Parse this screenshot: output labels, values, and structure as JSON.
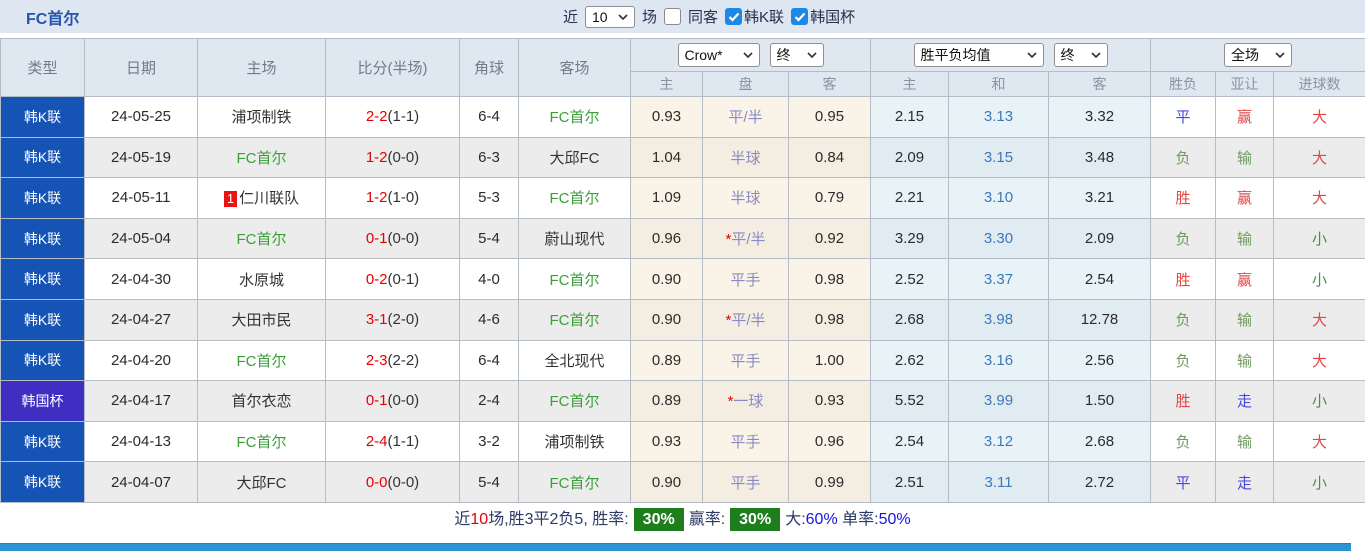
{
  "colors": {
    "league_badge_bg": "#1553b4",
    "cup_badge_bg": "#3e2ec2",
    "self_team_green": "#3aa03a",
    "score_red": "#e60000",
    "handicap_purple": "#8a8ac2",
    "draw_odds_blue": "#3f77b8",
    "status_red": "#e44545",
    "status_blue": "#4646e0",
    "status_green": "#6e9a60",
    "summary_badge_green": "#1e7e1e",
    "bottom_bar_blue": "#2b94d1",
    "checkbox_blue": "#1e88e5"
  },
  "topbar": {
    "title": "FC首尔",
    "recent_label": "近",
    "recent_count": "10",
    "unit_label": "场",
    "checkboxes": [
      {
        "id": "same-venue",
        "label": "同客",
        "checked": false
      },
      {
        "id": "league",
        "label": "韩K联",
        "checked": true
      },
      {
        "id": "cup",
        "label": "韩国杯",
        "checked": true
      }
    ]
  },
  "table": {
    "headers": {
      "type": "类型",
      "date": "日期",
      "home": "主场",
      "score": "比分(半场)",
      "corner": "角球",
      "away": "客场"
    },
    "controls": {
      "book": "Crow*",
      "book_state": "终",
      "avg": "胜平负均值",
      "avg_state": "终",
      "scope": "全场"
    },
    "sub_headers": [
      "主",
      "盘",
      "客",
      "主",
      "和",
      "客",
      "胜负",
      "亚让",
      "进球数"
    ],
    "rows": [
      {
        "type": "韩K联",
        "cup": false,
        "date": "24-05-25",
        "home": "浦项制铁",
        "home_self": false,
        "home_badge": "",
        "score": "2-2",
        "half": "(1-1)",
        "corner": "6-4",
        "away": "FC首尔",
        "away_self": true,
        "ah_home": "0.93",
        "ah_star": false,
        "ah_line": "平/半",
        "ah_away": "0.95",
        "avg_home": "2.15",
        "avg_draw": "3.13",
        "avg_away": "3.32",
        "result": "平",
        "handicap_result": "赢",
        "goals_result": "大"
      },
      {
        "type": "韩K联",
        "cup": false,
        "date": "24-05-19",
        "home": "FC首尔",
        "home_self": true,
        "home_badge": "",
        "score": "1-2",
        "half": "(0-0)",
        "corner": "6-3",
        "away": "大邱FC",
        "away_self": false,
        "ah_home": "1.04",
        "ah_star": false,
        "ah_line": "半球",
        "ah_away": "0.84",
        "avg_home": "2.09",
        "avg_draw": "3.15",
        "avg_away": "3.48",
        "result": "负",
        "handicap_result": "输",
        "goals_result": "大"
      },
      {
        "type": "韩K联",
        "cup": false,
        "date": "24-05-11",
        "home": "仁川联队",
        "home_self": false,
        "home_badge": "1",
        "score": "1-2",
        "half": "(1-0)",
        "corner": "5-3",
        "away": "FC首尔",
        "away_self": true,
        "ah_home": "1.09",
        "ah_star": false,
        "ah_line": "半球",
        "ah_away": "0.79",
        "avg_home": "2.21",
        "avg_draw": "3.10",
        "avg_away": "3.21",
        "result": "胜",
        "handicap_result": "赢",
        "goals_result": "大"
      },
      {
        "type": "韩K联",
        "cup": false,
        "date": "24-05-04",
        "home": "FC首尔",
        "home_self": true,
        "home_badge": "",
        "score": "0-1",
        "half": "(0-0)",
        "corner": "5-4",
        "away": "蔚山现代",
        "away_self": false,
        "ah_home": "0.96",
        "ah_star": true,
        "ah_line": "平/半",
        "ah_away": "0.92",
        "avg_home": "3.29",
        "avg_draw": "3.30",
        "avg_away": "2.09",
        "result": "负",
        "handicap_result": "输",
        "goals_result": "小"
      },
      {
        "type": "韩K联",
        "cup": false,
        "date": "24-04-30",
        "home": "水原城",
        "home_self": false,
        "home_badge": "",
        "score": "0-2",
        "half": "(0-1)",
        "corner": "4-0",
        "away": "FC首尔",
        "away_self": true,
        "ah_home": "0.90",
        "ah_star": false,
        "ah_line": "平手",
        "ah_away": "0.98",
        "avg_home": "2.52",
        "avg_draw": "3.37",
        "avg_away": "2.54",
        "result": "胜",
        "handicap_result": "赢",
        "goals_result": "小"
      },
      {
        "type": "韩K联",
        "cup": false,
        "date": "24-04-27",
        "home": "大田市民",
        "home_self": false,
        "home_badge": "",
        "score": "3-1",
        "half": "(2-0)",
        "corner": "4-6",
        "away": "FC首尔",
        "away_self": true,
        "ah_home": "0.90",
        "ah_star": true,
        "ah_line": "平/半",
        "ah_away": "0.98",
        "avg_home": "2.68",
        "avg_draw": "3.98",
        "avg_away": "12.78",
        "result": "负",
        "handicap_result": "输",
        "goals_result": "大"
      },
      {
        "type": "韩K联",
        "cup": false,
        "date": "24-04-20",
        "home": "FC首尔",
        "home_self": true,
        "home_badge": "",
        "score": "2-3",
        "half": "(2-2)",
        "corner": "6-4",
        "away": "全北现代",
        "away_self": false,
        "ah_home": "0.89",
        "ah_star": false,
        "ah_line": "平手",
        "ah_away": "1.00",
        "avg_home": "2.62",
        "avg_draw": "3.16",
        "avg_away": "2.56",
        "result": "负",
        "handicap_result": "输",
        "goals_result": "大"
      },
      {
        "type": "韩国杯",
        "cup": true,
        "date": "24-04-17",
        "home": "首尔衣恋",
        "home_self": false,
        "home_badge": "",
        "score": "0-1",
        "half": "(0-0)",
        "corner": "2-4",
        "away": "FC首尔",
        "away_self": true,
        "ah_home": "0.89",
        "ah_star": true,
        "ah_line": "一球",
        "ah_away": "0.93",
        "avg_home": "5.52",
        "avg_draw": "3.99",
        "avg_away": "1.50",
        "result": "胜",
        "handicap_result": "走",
        "goals_result": "小"
      },
      {
        "type": "韩K联",
        "cup": false,
        "date": "24-04-13",
        "home": "FC首尔",
        "home_self": true,
        "home_badge": "",
        "score": "2-4",
        "half": "(1-1)",
        "corner": "3-2",
        "away": "浦项制铁",
        "away_self": false,
        "ah_home": "0.93",
        "ah_star": false,
        "ah_line": "平手",
        "ah_away": "0.96",
        "avg_home": "2.54",
        "avg_draw": "3.12",
        "avg_away": "2.68",
        "result": "负",
        "handicap_result": "输",
        "goals_result": "大"
      },
      {
        "type": "韩K联",
        "cup": false,
        "date": "24-04-07",
        "home": "大邱FC",
        "home_self": false,
        "home_badge": "",
        "score": "0-0",
        "half": "(0-0)",
        "corner": "5-4",
        "away": "FC首尔",
        "away_self": true,
        "ah_home": "0.90",
        "ah_star": false,
        "ah_line": "平手",
        "ah_away": "0.99",
        "avg_home": "2.51",
        "avg_draw": "3.11",
        "avg_away": "2.72",
        "result": "平",
        "handicap_result": "走",
        "goals_result": "小"
      }
    ]
  },
  "summary": {
    "segments": [
      {
        "text": "近",
        "style": "label"
      },
      {
        "text": "10",
        "style": "red"
      },
      {
        "text": "场,胜3平2负5, 胜率:",
        "style": "label"
      },
      {
        "text": "30%",
        "style": "badge"
      },
      {
        "text": "赢率:",
        "style": "label"
      },
      {
        "text": "30%",
        "style": "badge"
      },
      {
        "text": "大:",
        "style": "label"
      },
      {
        "text": "60%",
        "style": "blue"
      },
      {
        "text": " 单率:",
        "style": "label"
      },
      {
        "text": "50%",
        "style": "blue"
      }
    ]
  }
}
